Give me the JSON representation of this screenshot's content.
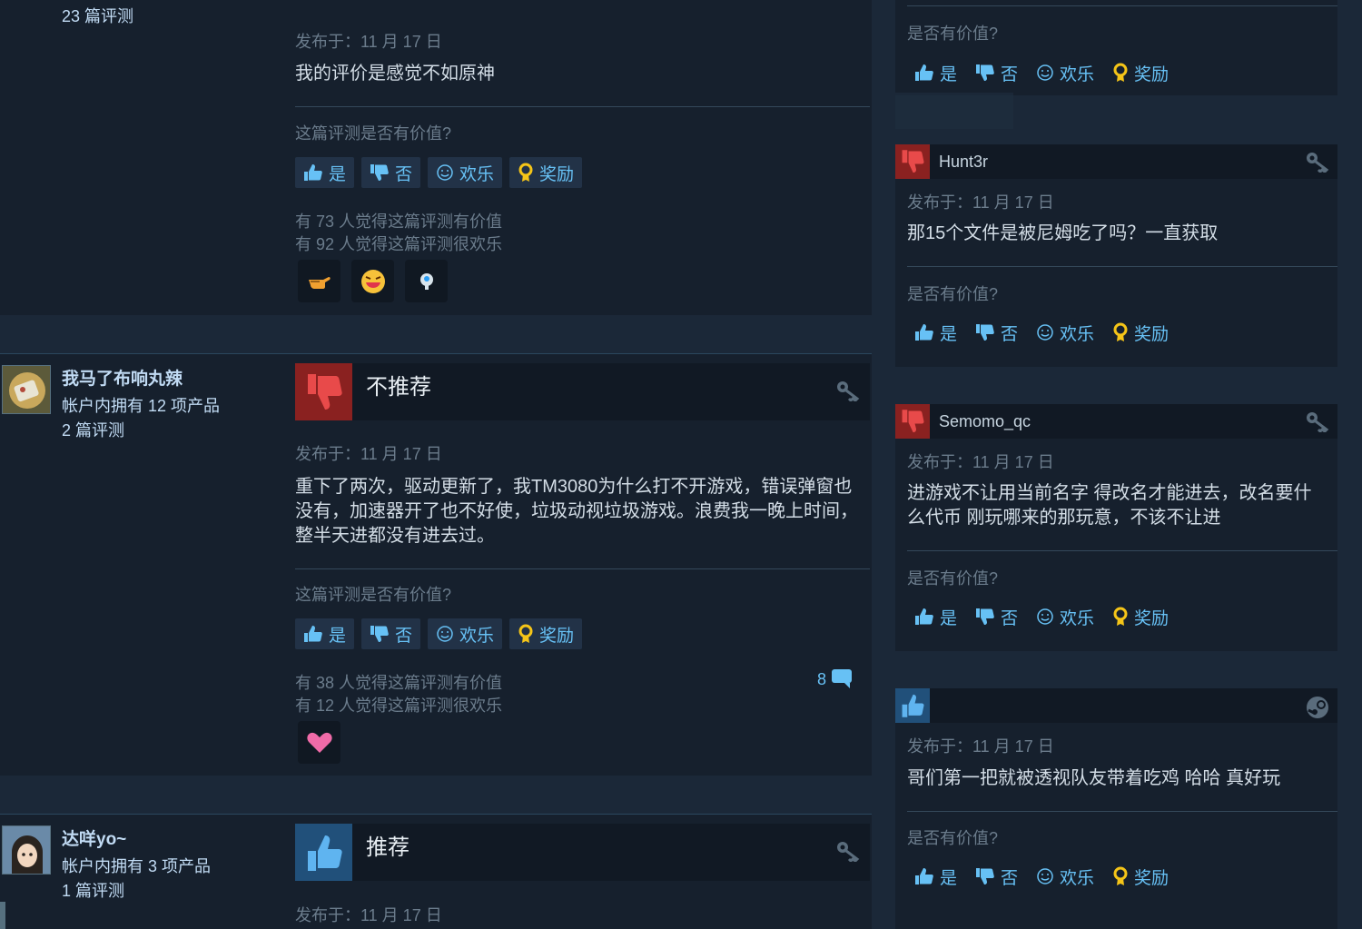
{
  "review_labels": {
    "helpful_question": "这篇评测是否有价值?",
    "short_helpful_question": "是否有价值?",
    "yes": "是",
    "no": "否",
    "funny": "欢乐",
    "award": "奖励"
  },
  "left_reviews": [
    {
      "author_reviews": "23 篇评测",
      "date": "发布于：11 月 17 日",
      "text": "我的评价是感觉不如原神",
      "helpful_count": "有 73 人觉得这篇评测有价值",
      "funny_count": "有 92 人觉得这篇评测很欢乐",
      "awards": [
        "pointing-hand-icon",
        "laughing-face-icon",
        "mind-blown-icon"
      ]
    },
    {
      "author_name": "我马了布响丸辣",
      "author_products": "帐户内拥有 12 项产品",
      "author_reviews": "2 篇评测",
      "recommendation": "不推荐",
      "date": "发布于：11 月 17 日",
      "text": "重下了两次，驱动更新了，我TM3080为什么打不开游戏，错误弹窗也没有，加速器开了也不好使，垃圾动视垃圾游戏。浪费我一晚上时间，整半天进都没有进去过。",
      "helpful_count": "有 38 人觉得这篇评测有价值",
      "funny_count": "有 12 人觉得这篇评测很欢乐",
      "comments": "8",
      "awards": [
        "heart-icon"
      ]
    },
    {
      "author_name": "达咩yo~",
      "author_products": "帐户内拥有 3 项产品",
      "author_reviews": "1 篇评测",
      "recommendation": "推荐",
      "date": "发布于：11 月 17 日"
    }
  ],
  "right_reviews": [
    {
      "helpful_q": "是否有价值?"
    },
    {
      "author_name": "Hunt3r",
      "date": "发布于：11 月 17 日",
      "text": "那15个文件是被尼姆吃了吗？一直获取"
    },
    {
      "author_name": "Semomo_qc",
      "date": "发布于：11 月 17 日",
      "text": "进游戏不让用当前名字 得改名才能进去，改名要什么代币 刚玩哪来的那玩意，不该不让进"
    },
    {
      "author_name": "",
      "date": "发布于：11 月 17 日",
      "text": "哥们第一把就被透视队友带着吃鸡 哈哈 真好玩"
    }
  ],
  "colors": {
    "background": "#1b2838",
    "panel": "#16202d",
    "link_blue": "#67c1f5",
    "not_recommended": "#8a2120",
    "recommended": "#21507a"
  }
}
